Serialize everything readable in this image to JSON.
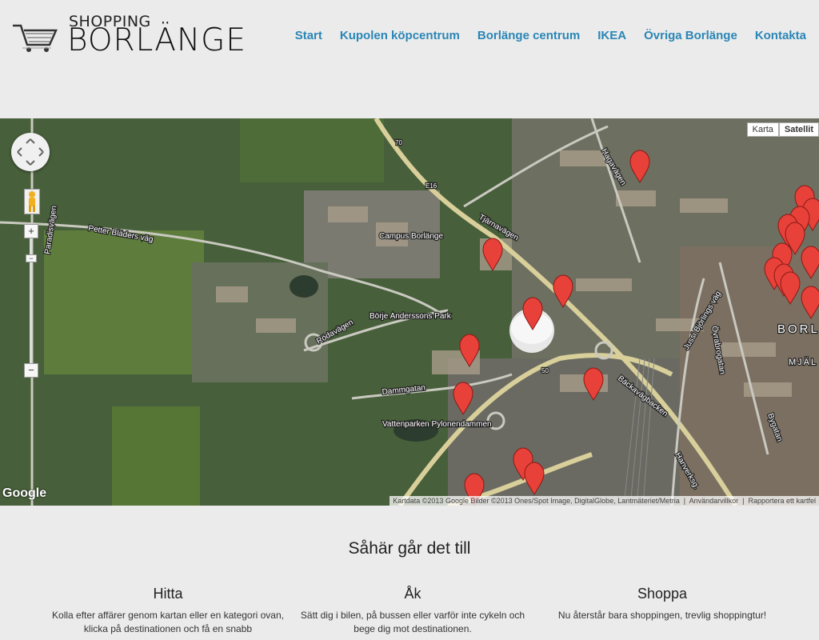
{
  "logo": {
    "small": "SHOPPING",
    "big": "BORLÄNGE"
  },
  "nav": [
    "Start",
    "Kupolen köpcentrum",
    "Borlänge centrum",
    "IKEA",
    "Övriga Borlänge",
    "Kontakta"
  ],
  "map": {
    "type_buttons": [
      "Karta",
      "Satellit"
    ],
    "attribution": "Kartdata ©2013 Google Bilder ©2013 Ones/Spot Image, DigitalGlobe, Lantmäteriet/Metria",
    "terms": "Användarvillkor",
    "report": "Rapportera ett kartfel",
    "google": "Google",
    "zoom_in": "+",
    "zoom_out": "−",
    "labels": [
      "Petter Bläders väg",
      "Paradisvägen",
      "Rödavägen",
      "Campus Borlänge",
      "Tjärnavägen",
      "Hagavägen",
      "Börje Anderssons Park",
      "Dammgatan",
      "Vattenparken Pylonendammen",
      "Bäckavägbacken",
      "Hanverksg.",
      "Jussi Björlings väg",
      "Bygatan",
      "Övrabrogatan",
      "BORL",
      "MJÄL",
      "E16",
      "70",
      "50"
    ]
  },
  "main": {
    "title": "Såhär går det till",
    "columns": [
      {
        "heading": "Hitta",
        "text": "Kolla efter affärer genom kartan eller en kategori ovan, klicka på destinationen och få en snabb"
      },
      {
        "heading": "Åk",
        "text": "Sätt dig i bilen, på bussen eller varför inte cykeln och bege dig mot destinationen."
      },
      {
        "heading": "Shoppa",
        "text": "Nu återstår bara shoppingen, trevlig shoppingtur!"
      }
    ]
  }
}
